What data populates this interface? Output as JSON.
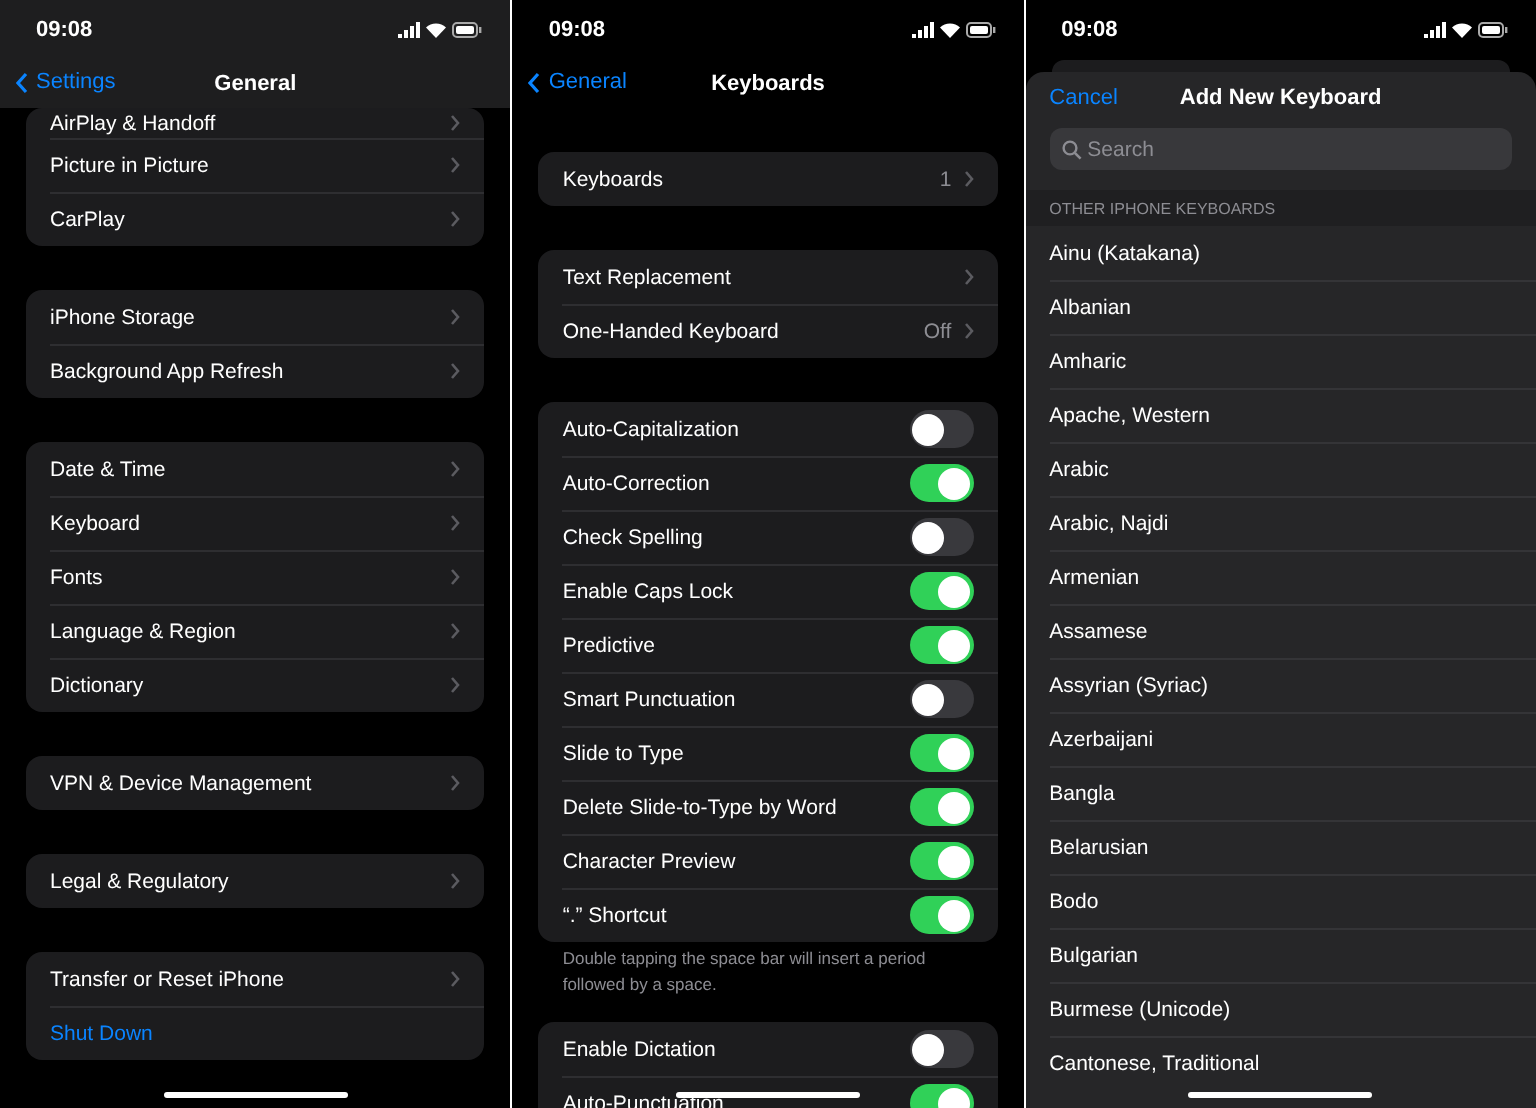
{
  "general_screen": {
    "status_bar": {
      "time": "09:08"
    },
    "nav": {
      "back": "Settings",
      "title": "General"
    },
    "groups": [
      {
        "rows": [
          {
            "kind": "link",
            "label": "AirPlay & Handoff"
          },
          {
            "kind": "link",
            "label": "Picture in Picture"
          },
          {
            "kind": "link",
            "label": "CarPlay"
          }
        ]
      },
      {
        "rows": [
          {
            "kind": "link",
            "label": "iPhone Storage"
          },
          {
            "kind": "link",
            "label": "Background App Refresh"
          }
        ]
      },
      {
        "rows": [
          {
            "kind": "link",
            "label": "Date & Time"
          },
          {
            "kind": "link",
            "label": "Keyboard"
          },
          {
            "kind": "link",
            "label": "Fonts"
          },
          {
            "kind": "link",
            "label": "Language & Region"
          },
          {
            "kind": "link",
            "label": "Dictionary"
          }
        ]
      },
      {
        "rows": [
          {
            "kind": "link",
            "label": "VPN & Device Management"
          }
        ]
      },
      {
        "rows": [
          {
            "kind": "link",
            "label": "Legal & Regulatory"
          }
        ]
      },
      {
        "rows": [
          {
            "kind": "link",
            "label": "Transfer or Reset iPhone"
          },
          {
            "kind": "action",
            "label": "Shut Down"
          }
        ]
      }
    ]
  },
  "keyboards_screen": {
    "status_bar": {
      "time": "09:08"
    },
    "nav": {
      "back": "General",
      "title": "Keyboards"
    },
    "groups": [
      {
        "rows": [
          {
            "kind": "link",
            "label": "Keyboards",
            "value": "1"
          }
        ]
      },
      {
        "rows": [
          {
            "kind": "link",
            "label": "Text Replacement"
          },
          {
            "kind": "link",
            "label": "One-Handed Keyboard",
            "value": "Off"
          }
        ]
      },
      {
        "rows": [
          {
            "kind": "toggle",
            "label": "Auto-Capitalization",
            "on": false
          },
          {
            "kind": "toggle",
            "label": "Auto-Correction",
            "on": true
          },
          {
            "kind": "toggle",
            "label": "Check Spelling",
            "on": false
          },
          {
            "kind": "toggle",
            "label": "Enable Caps Lock",
            "on": true
          },
          {
            "kind": "toggle",
            "label": "Predictive",
            "on": true
          },
          {
            "kind": "toggle",
            "label": "Smart Punctuation",
            "on": false
          },
          {
            "kind": "toggle",
            "label": "Slide to Type",
            "on": true
          },
          {
            "kind": "toggle",
            "label": "Delete Slide-to-Type by Word",
            "on": true
          },
          {
            "kind": "toggle",
            "label": "Character Preview",
            "on": true
          },
          {
            "kind": "toggle",
            "label": "“.” Shortcut",
            "on": true
          }
        ],
        "footnote": "Double tapping the space bar will insert a period followed by a space."
      },
      {
        "rows": [
          {
            "kind": "toggle",
            "label": "Enable Dictation",
            "on": false
          },
          {
            "kind": "toggle",
            "label": "Auto-Punctuation",
            "on": true
          }
        ]
      }
    ]
  },
  "add_keyboard_sheet": {
    "status_bar": {
      "time": "09:08"
    },
    "cancel": "Cancel",
    "title": "Add New Keyboard",
    "search": {
      "placeholder": "Search"
    },
    "section_header": "OTHER IPHONE KEYBOARDS",
    "languages": [
      "Ainu (Katakana)",
      "Albanian",
      "Amharic",
      "Apache, Western",
      "Arabic",
      "Arabic, Najdi",
      "Armenian",
      "Assamese",
      "Assyrian (Syriac)",
      "Azerbaijani",
      "Bangla",
      "Belarusian",
      "Bodo",
      "Bulgarian",
      "Burmese (Unicode)",
      "Cantonese, Traditional"
    ]
  }
}
